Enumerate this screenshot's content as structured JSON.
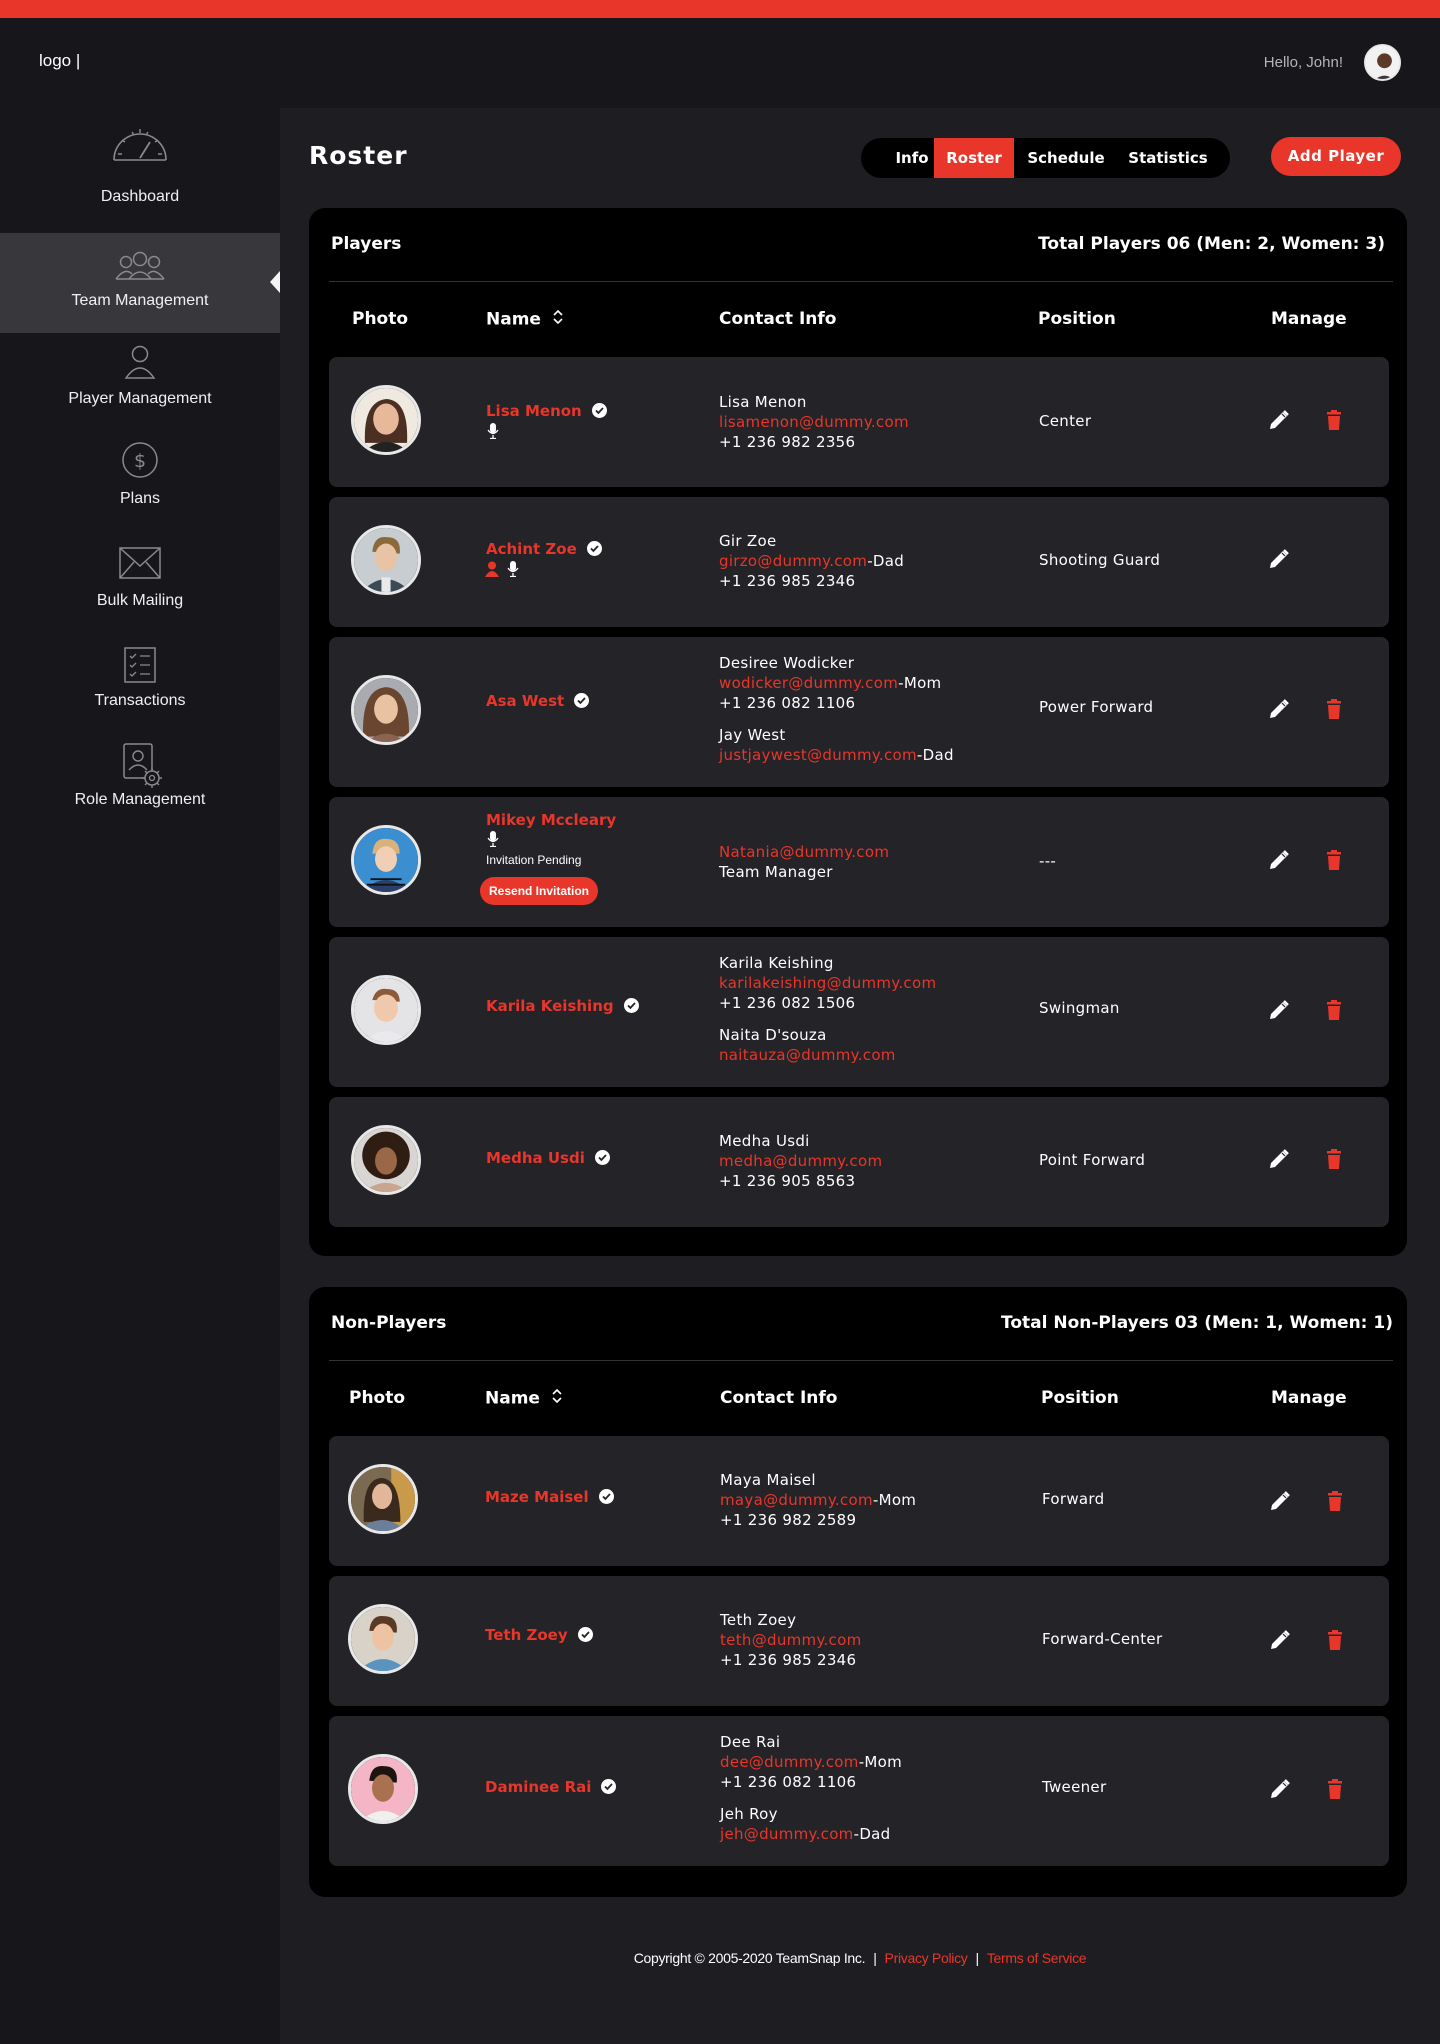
{
  "header": {
    "logo": "logo |",
    "greeting": "Hello, John!"
  },
  "sidebar": {
    "items": [
      {
        "label": "Dashboard",
        "icon": "speedometer-icon"
      },
      {
        "label": "Team Management",
        "icon": "team-icon",
        "active": true
      },
      {
        "label": "Player Management",
        "icon": "user-icon"
      },
      {
        "label": "Plans",
        "icon": "dollar-icon"
      },
      {
        "label": "Bulk Mailing",
        "icon": "mail-icon"
      },
      {
        "label": "Transactions",
        "icon": "checklist-icon"
      },
      {
        "label": "Role Management",
        "icon": "user-settings-icon"
      }
    ]
  },
  "page": {
    "title": "Roster",
    "add_button": "Add Player"
  },
  "tabs": [
    {
      "label": "Info"
    },
    {
      "label": "Roster",
      "active": true
    },
    {
      "label": "Schedule"
    },
    {
      "label": "Statistics"
    }
  ],
  "players": {
    "title": "Players",
    "total": "Total Players 06 (Men: 2, Women: 3)",
    "columns": {
      "photo": "Photo",
      "name": "Name",
      "contact": "Contact Info",
      "position": "Position",
      "manage": "Manage"
    },
    "rows": [
      {
        "name": "Lisa Menon",
        "position": "Center",
        "contact": [
          {
            "name": "Lisa Menon",
            "email": "lisamenon@dummy.com",
            "relation": "",
            "phone": "+1 236 982 2356"
          }
        ]
      },
      {
        "name": "Achint Zoe",
        "position": "Shooting Guard",
        "contact": [
          {
            "name": "Gir Zoe",
            "email": "girzo@dummy.com",
            "relation": "-Dad",
            "phone": "+1 236 985 2346"
          }
        ]
      },
      {
        "name": "Asa West",
        "position": "Power Forward",
        "contact": [
          {
            "name": "Desiree Wodicker",
            "email": "wodicker@dummy.com",
            "relation": "-Mom",
            "phone": "+1 236 082 1106"
          },
          {
            "name": "Jay West",
            "email": "justjaywest@dummy.com",
            "relation": "-Dad"
          }
        ]
      },
      {
        "name": "Mikey Mccleary",
        "position": "---",
        "status": "Invitation Pending",
        "resend": "Resend Invitation",
        "contact": [
          {
            "email": "Natania@dummy.com",
            "role": "Team Manager"
          }
        ]
      },
      {
        "name": "Karila Keishing",
        "position": "Swingman",
        "contact": [
          {
            "name": "Karila Keishing",
            "email": "karilakeishing@dummy.com",
            "phone": "+1 236 082 1506"
          },
          {
            "name": "Naita D'souza",
            "email": "naitauza@dummy.com"
          }
        ]
      },
      {
        "name": "Medha Usdi",
        "position": "Point Forward",
        "contact": [
          {
            "name": "Medha Usdi",
            "email": "medha@dummy.com",
            "phone": "+1 236 905 8563"
          }
        ]
      }
    ]
  },
  "non_players": {
    "title": "Non-Players",
    "total": "Total Non-Players 03 (Men: 1, Women: 1)",
    "columns": {
      "photo": "Photo",
      "name": "Name",
      "contact": "Contact Info",
      "position": "Position",
      "manage": "Manage"
    },
    "rows": [
      {
        "name": "Maze Maisel",
        "position": "Forward",
        "contact": [
          {
            "name": "Maya Maisel",
            "email": "maya@dummy.com",
            "relation": "-Mom",
            "phone": "+1 236 982 2589"
          }
        ]
      },
      {
        "name": "Teth Zoey",
        "position": "Forward-Center",
        "contact": [
          {
            "name": "Teth Zoey",
            "email": "teth@dummy.com",
            "phone": "+1 236 985 2346"
          }
        ]
      },
      {
        "name": "Daminee Rai",
        "position": "Tweener",
        "contact": [
          {
            "name": "Dee Rai",
            "email": "dee@dummy.com",
            "relation": "-Mom",
            "phone": "+1 236 082 1106"
          },
          {
            "name": "Jeh Roy",
            "email": "jeh@dummy.com",
            "relation": "-Dad"
          }
        ]
      }
    ]
  },
  "footer": {
    "copyright": "Copyright © 2005-2020 TeamSnap Inc.",
    "sep": "|",
    "privacy": "Privacy Policy",
    "terms": "Terms of Service"
  },
  "colors": {
    "accent": "#e8362a",
    "background": "#1e1e22",
    "panel": "#000000",
    "row": "#232328",
    "sidebar": "#17171b"
  }
}
